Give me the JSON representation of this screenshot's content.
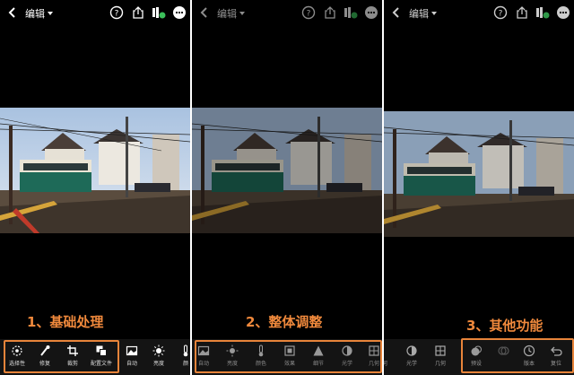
{
  "header": {
    "title": "编辑"
  },
  "panels": [
    {
      "caption": "1、基础处理",
      "tools": [
        "选择性",
        "修复",
        "裁剪",
        "配置文件",
        "自动",
        "亮度",
        "颜"
      ]
    },
    {
      "caption": "2、整体调整",
      "tools": [
        "自动",
        "亮度",
        "颜色",
        "效果",
        "细节",
        "光学",
        "几何"
      ]
    },
    {
      "caption": "3、其他功能",
      "tools": [
        "何",
        "光学",
        "几何",
        "预设",
        "",
        "版本",
        "复位"
      ]
    }
  ],
  "colors": {
    "accent": "#e8843a",
    "caption": "#f0893c",
    "toolbar_bg": "#141414"
  },
  "icons": [
    "back-chevron-icon",
    "help-icon",
    "share-icon",
    "cloud-sync-icon",
    "more-icon"
  ]
}
